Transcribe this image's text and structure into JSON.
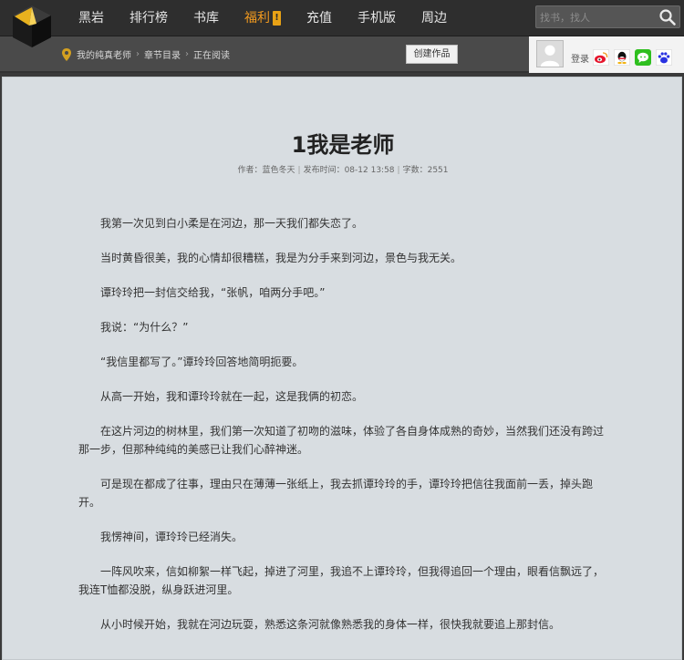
{
  "nav": {
    "items": [
      "黑岩",
      "排行榜",
      "书库",
      "福利",
      "充值",
      "手机版",
      "周边"
    ],
    "active_index": 3,
    "badge": "!",
    "active_color": "#f29a1f"
  },
  "search": {
    "placeholder": "找书，找人"
  },
  "breadcrumb": [
    "我的纯真老师",
    "章节目录",
    "正在阅读"
  ],
  "create_button": "创建作品",
  "user": {
    "login_label": "登录"
  },
  "chapter": {
    "title": "1我是老师",
    "author_label": "作者：",
    "author": "蓝色冬天",
    "time_label": "发布时间：",
    "time": "08-12 13:58",
    "words_label": "字数：",
    "words": "2551"
  },
  "paragraphs": [
    "我第一次见到白小柔是在河边，那一天我们都失恋了。",
    "当时黄昏很美，我的心情却很糟糕，我是为分手来到河边，景色与我无关。",
    "谭玲玲把一封信交给我，“张帆，咱两分手吧。”",
    "我说：“为什么？”",
    "“我信里都写了。”谭玲玲回答地简明扼要。",
    "从高一开始，我和谭玲玲就在一起，这是我俩的初恋。",
    "在这片河边的树林里，我们第一次知道了初吻的滋味，体验了各自身体成熟的奇妙，当然我们还没有跨过那一步，但那种纯纯的美感已让我们心醉神迷。",
    "可是现在都成了往事，理由只在薄薄一张纸上，我去抓谭玲玲的手，谭玲玲把信往我面前一丢，掉头跑开。",
    "我愣神间，谭玲玲已经消失。",
    "一阵风吹来，信如柳絮一样飞起，掉进了河里，我追不上谭玲玲，但我得追回一个理由，眼看信飘远了，我连T恤都没脱，纵身跃进河里。",
    "从小时候开始，我就在河边玩耍，熟悉这条河就像熟悉我的身体一样，很快我就要追上那封信。"
  ],
  "icons": {
    "logo": "logo-cube-icon",
    "search": "search-icon",
    "pin": "location-pin-icon",
    "weibo": "weibo-icon",
    "qq": "qq-icon",
    "wechat": "wechat-icon",
    "baidu": "baidu-icon"
  },
  "colors": {
    "topbar": "#2e2e2e",
    "subbar": "#4a4a4a",
    "content_bg": "#d8dde1"
  }
}
